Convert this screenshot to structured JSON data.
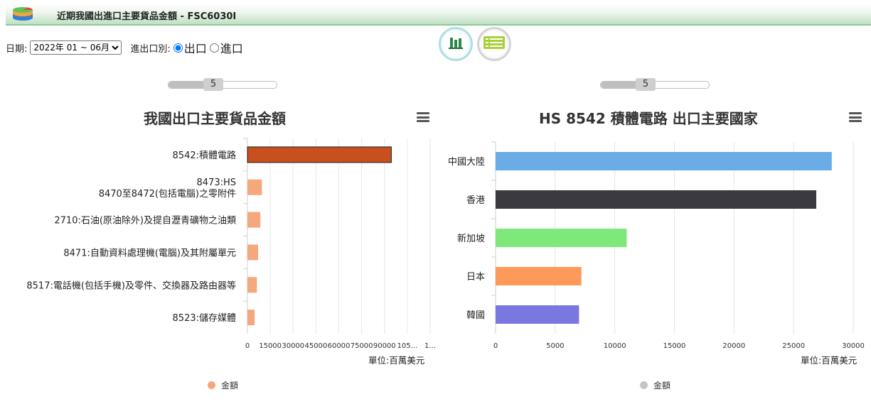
{
  "header": {
    "title": "近期我國出進口主要貨品金額 - FSC6030I"
  },
  "filters": {
    "date_label": "日期:",
    "date_selected": "2022年 01 ~ 06月",
    "type_label": "進出口別:",
    "export_label": "出口",
    "import_label": "進口",
    "selected": "export"
  },
  "sliders": {
    "left_value": "5",
    "right_value": "5"
  },
  "colors": {
    "left_highlight": "#c8501e",
    "left_other": "#f5a77d",
    "right_bars": [
      "#6aace6",
      "#3a3a40",
      "#7ee87a",
      "#fd9a5a",
      "#7a78e0"
    ],
    "left_legend": "#f5a77d",
    "right_legend": "#c4c4c4"
  },
  "chart_data": [
    {
      "type": "bar",
      "orientation": "horizontal",
      "title": "我國出口主要貨品金額",
      "categories": [
        "8542:積體電路",
        "8473:HS 8470至8472(包括電腦)之零附件",
        "2710:石油(原油除外)及提自瀝青礦物之油類",
        "8471:自動資料處理機(電腦)及其附屬單元",
        "8517:電話機(包括手機)及零件、交換器及路由器等",
        "8523:儲存媒體"
      ],
      "category_lines": [
        [
          "8542:積體電路"
        ],
        [
          "8473:HS",
          "8470至8472(包括電腦)之零附件"
        ],
        [
          "2710:石油(原油除外)及提自瀝青礦物之油類"
        ],
        [
          "8471:自動資料處理機(電腦)及其附屬單元"
        ],
        [
          "8517:電話機(包括手機)及零件、交換器及路由器等"
        ],
        [
          "8523:儲存媒體"
        ]
      ],
      "series": [
        {
          "name": "金額",
          "values": [
            94500,
            9500,
            8500,
            7000,
            6200,
            4700
          ]
        }
      ],
      "xticks": [
        "0",
        "15000",
        "30000",
        "45000",
        "60000",
        "75000",
        "90000",
        "105...",
        "1..."
      ],
      "xlim": [
        0,
        120000
      ],
      "xlabel": "單位:百萬美元",
      "legend": "bottom-center"
    },
    {
      "type": "bar",
      "orientation": "horizontal",
      "title": "HS 8542 積體電路 出口主要國家",
      "categories": [
        "中國大陸",
        "香港",
        "新加坡",
        "日本",
        "韓國"
      ],
      "series": [
        {
          "name": "金額",
          "values": [
            28200,
            26900,
            11000,
            7200,
            7000
          ]
        }
      ],
      "xticks": [
        "0",
        "5000",
        "10000",
        "15000",
        "20000",
        "25000",
        "30000"
      ],
      "xlim": [
        0,
        30000
      ],
      "xlabel": "單位:百萬美元",
      "legend": "bottom-center"
    }
  ]
}
